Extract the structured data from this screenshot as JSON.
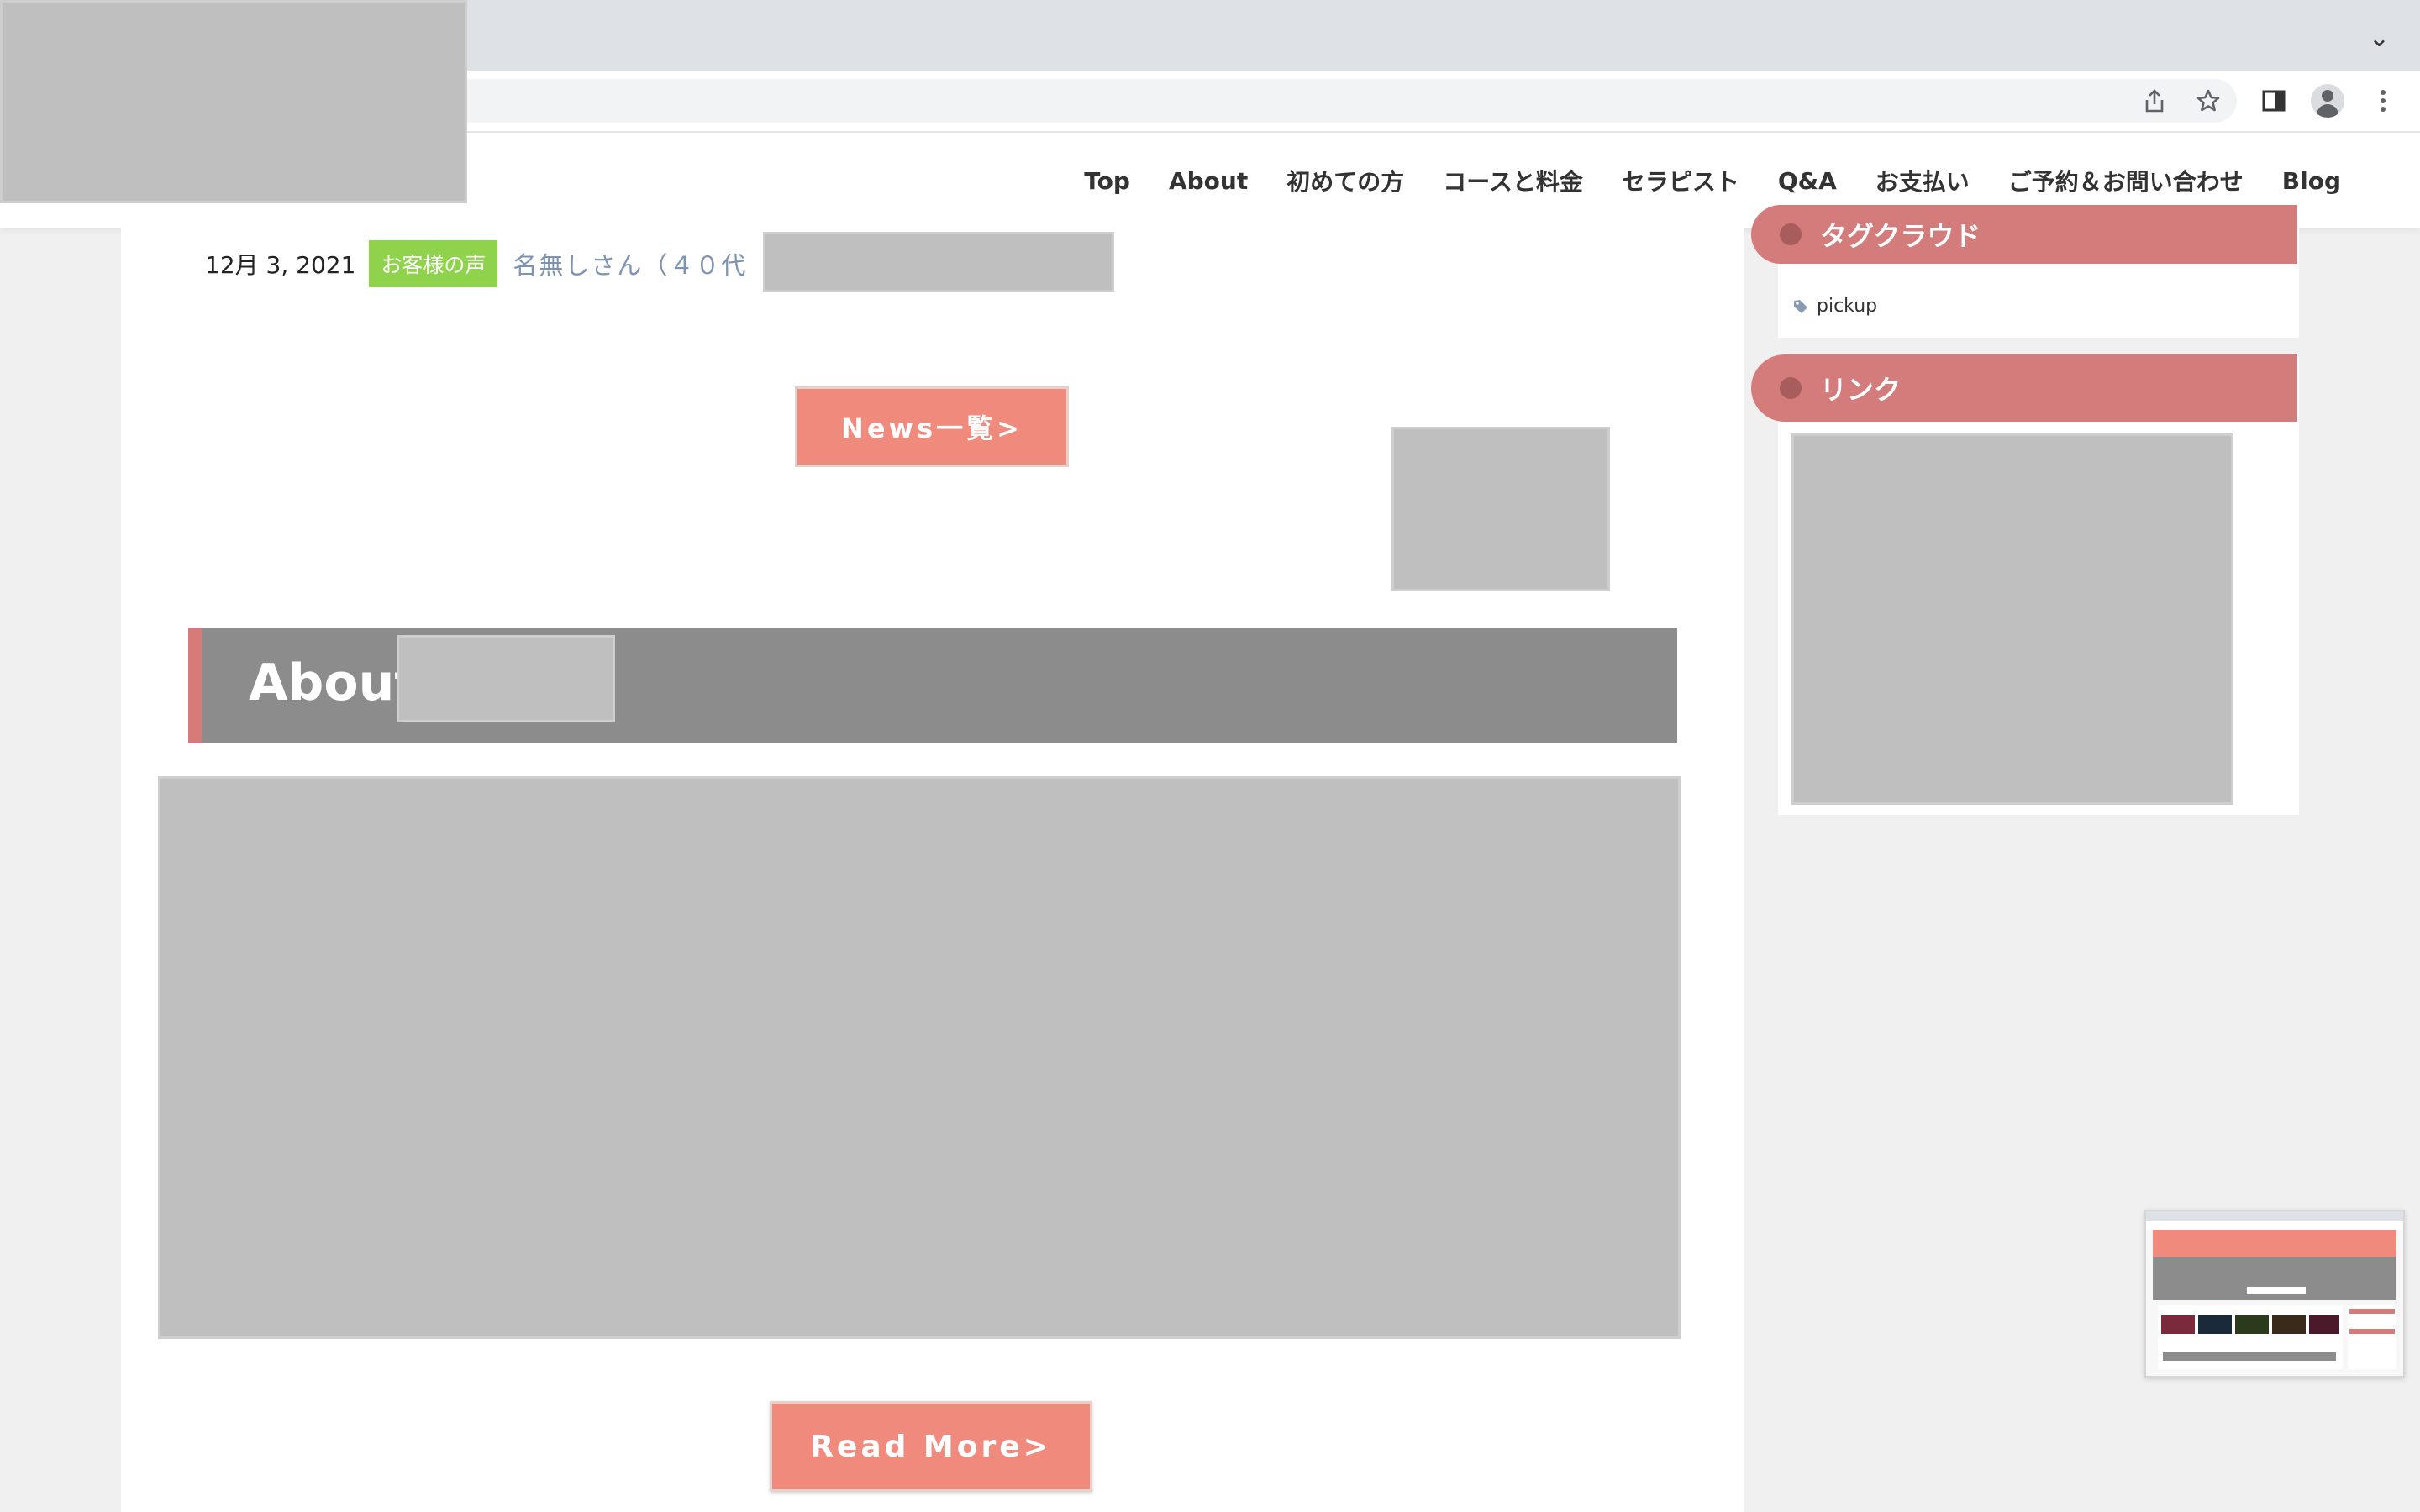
{
  "browser": {
    "tab_chevron": "⌄",
    "toolbar_icons": [
      "share-icon",
      "star-icon",
      "side-panel-icon",
      "profile-icon",
      "more-icon"
    ]
  },
  "nav": {
    "items": [
      "Top",
      "About",
      "初めての方",
      "コースと料金",
      "セラピスト",
      "Q&A",
      "お支払い",
      "ご予約＆お問い合わせ",
      "Blog"
    ]
  },
  "post": {
    "date": "12月 3, 2021",
    "category": "お客様の声",
    "title": "名無しさん（４０代"
  },
  "buttons": {
    "news_list": "News一覧>",
    "read_more": "Read More>"
  },
  "about": {
    "title": "About"
  },
  "sidebar": {
    "tag_cloud_title": "タグクラウド",
    "tag": "pickup",
    "links_title": "リンク"
  },
  "colors": {
    "accent": "#ef8a7d",
    "widget_header": "#d47c7c",
    "category_badge": "#8fd34c"
  }
}
